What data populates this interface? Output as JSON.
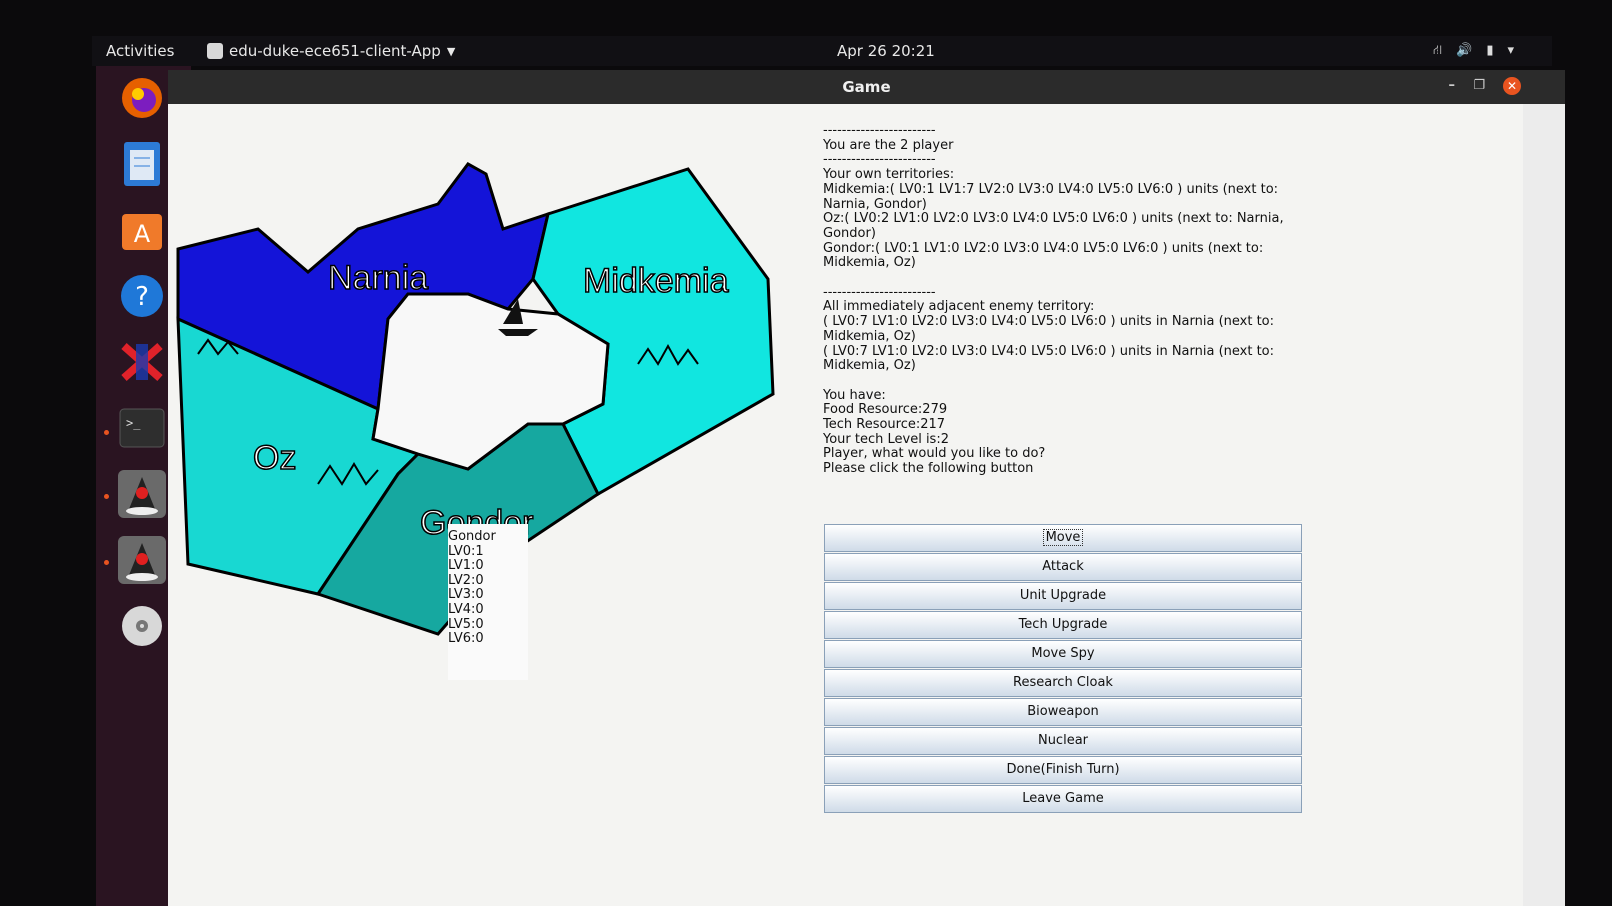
{
  "topbar": {
    "activities": "Activities",
    "app_name": "edu-duke-ece651-client-App",
    "clock": "Apr 26 20:21"
  },
  "dock": {
    "items": [
      "firefox-icon",
      "files-icon",
      "software-icon",
      "help-icon",
      "xming-icon",
      "terminal-icon",
      "java-icon",
      "java-icon-2",
      "disc-icon"
    ]
  },
  "window": {
    "title": "Game"
  },
  "map": {
    "territories": [
      "Narnia",
      "Midkemia",
      "Oz",
      "Gondor"
    ],
    "colors": {
      "narnia": "#1414d8",
      "midkemia": "#11e6e0",
      "oz": "#18d8d2",
      "gondor": "#16a8a0",
      "ocean": "#f8f8f8"
    }
  },
  "tooltip": {
    "lines": [
      "Gondor",
      "LV0:1",
      "LV1:0",
      "LV2:0",
      "LV3:0",
      "LV4:0",
      "LV5:0",
      "LV6:0"
    ]
  },
  "info": {
    "lines": [
      "------------------------",
      "You are the 2 player",
      "------------------------",
      "Your own territories:",
      "Midkemia:( LV0:1 LV1:7 LV2:0 LV3:0 LV4:0 LV5:0 LV6:0 ) units (next to:",
      "Narnia, Gondor)",
      "Oz:( LV0:2 LV1:0 LV2:0 LV3:0 LV4:0 LV5:0 LV6:0 ) units (next to: Narnia,",
      "Gondor)",
      "Gondor:( LV0:1 LV1:0 LV2:0 LV3:0 LV4:0 LV5:0 LV6:0 ) units (next to:",
      "Midkemia, Oz)",
      "",
      "------------------------",
      "All immediately adjacent enemy territory:",
      "( LV0:7 LV1:0 LV2:0 LV3:0 LV4:0 LV5:0 LV6:0 ) units in Narnia (next to:",
      "Midkemia, Oz)",
      "( LV0:7 LV1:0 LV2:0 LV3:0 LV4:0 LV5:0 LV6:0 ) units in Narnia (next to:",
      "Midkemia, Oz)",
      "",
      "You have:",
      "Food Resource:279",
      "Tech Resource:217",
      "Your tech Level is:2",
      "Player, what would you like to do?",
      "Please click the following button"
    ]
  },
  "buttons": [
    "Move",
    "Attack",
    "Unit Upgrade",
    "Tech Upgrade",
    "Move Spy",
    "Research Cloak",
    "Bioweapon",
    "Nuclear",
    "Done(Finish Turn)",
    "Leave Game"
  ]
}
